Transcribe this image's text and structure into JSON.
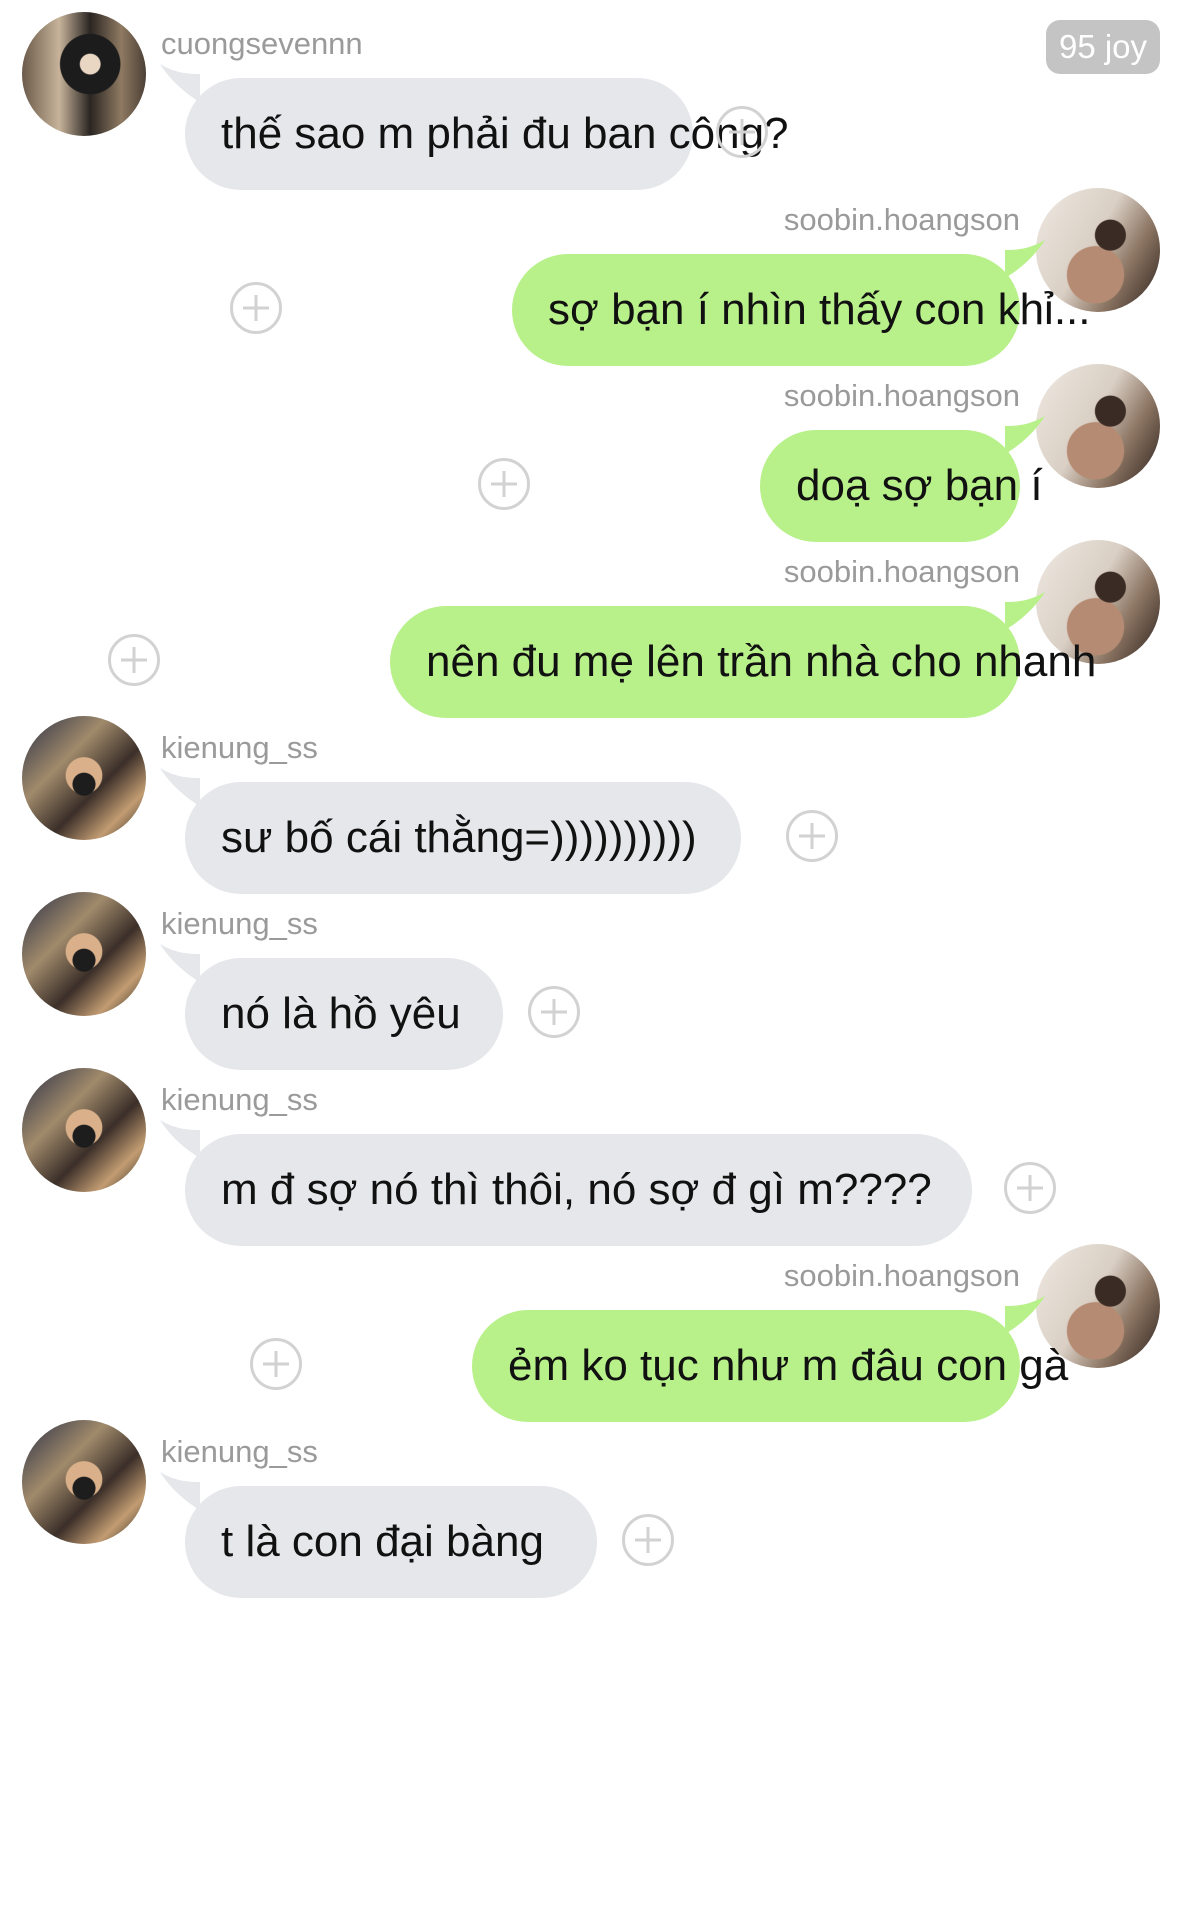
{
  "badge": {
    "label": "95 joy"
  },
  "messages": [
    {
      "user": "cuongsevennn",
      "text": "thế sao m phải đu ban công?"
    },
    {
      "user": "soobin.hoangson",
      "text": "sợ bạn í nhìn thấy con khỉ..."
    },
    {
      "user": "soobin.hoangson",
      "text": "doạ sợ bạn í"
    },
    {
      "user": "soobin.hoangson",
      "text": "nên đu mẹ lên trần nhà cho nhanh"
    },
    {
      "user": "kienung_ss",
      "text": "sư bố cái thằng=))))))))))"
    },
    {
      "user": "kienung_ss",
      "text": "nó là hồ yêu"
    },
    {
      "user": "kienung_ss",
      "text": "m đ sợ nó thì thôi, nó sợ đ gì m????"
    },
    {
      "user": "soobin.hoangson",
      "text": "ẻm ko tục như m đâu con gà"
    },
    {
      "user": "kienung_ss",
      "text": "t là con đại bàng"
    }
  ],
  "icons": {
    "add_reaction": "plus-circle-icon",
    "avatar": "avatar-photo"
  },
  "colors": {
    "incoming_bubble": "#e6e7eb",
    "outgoing_bubble": "#b8f08a",
    "username": "#9a9a9a",
    "plus_icon": "#d2d2d2",
    "badge": "#c4c4c4"
  }
}
